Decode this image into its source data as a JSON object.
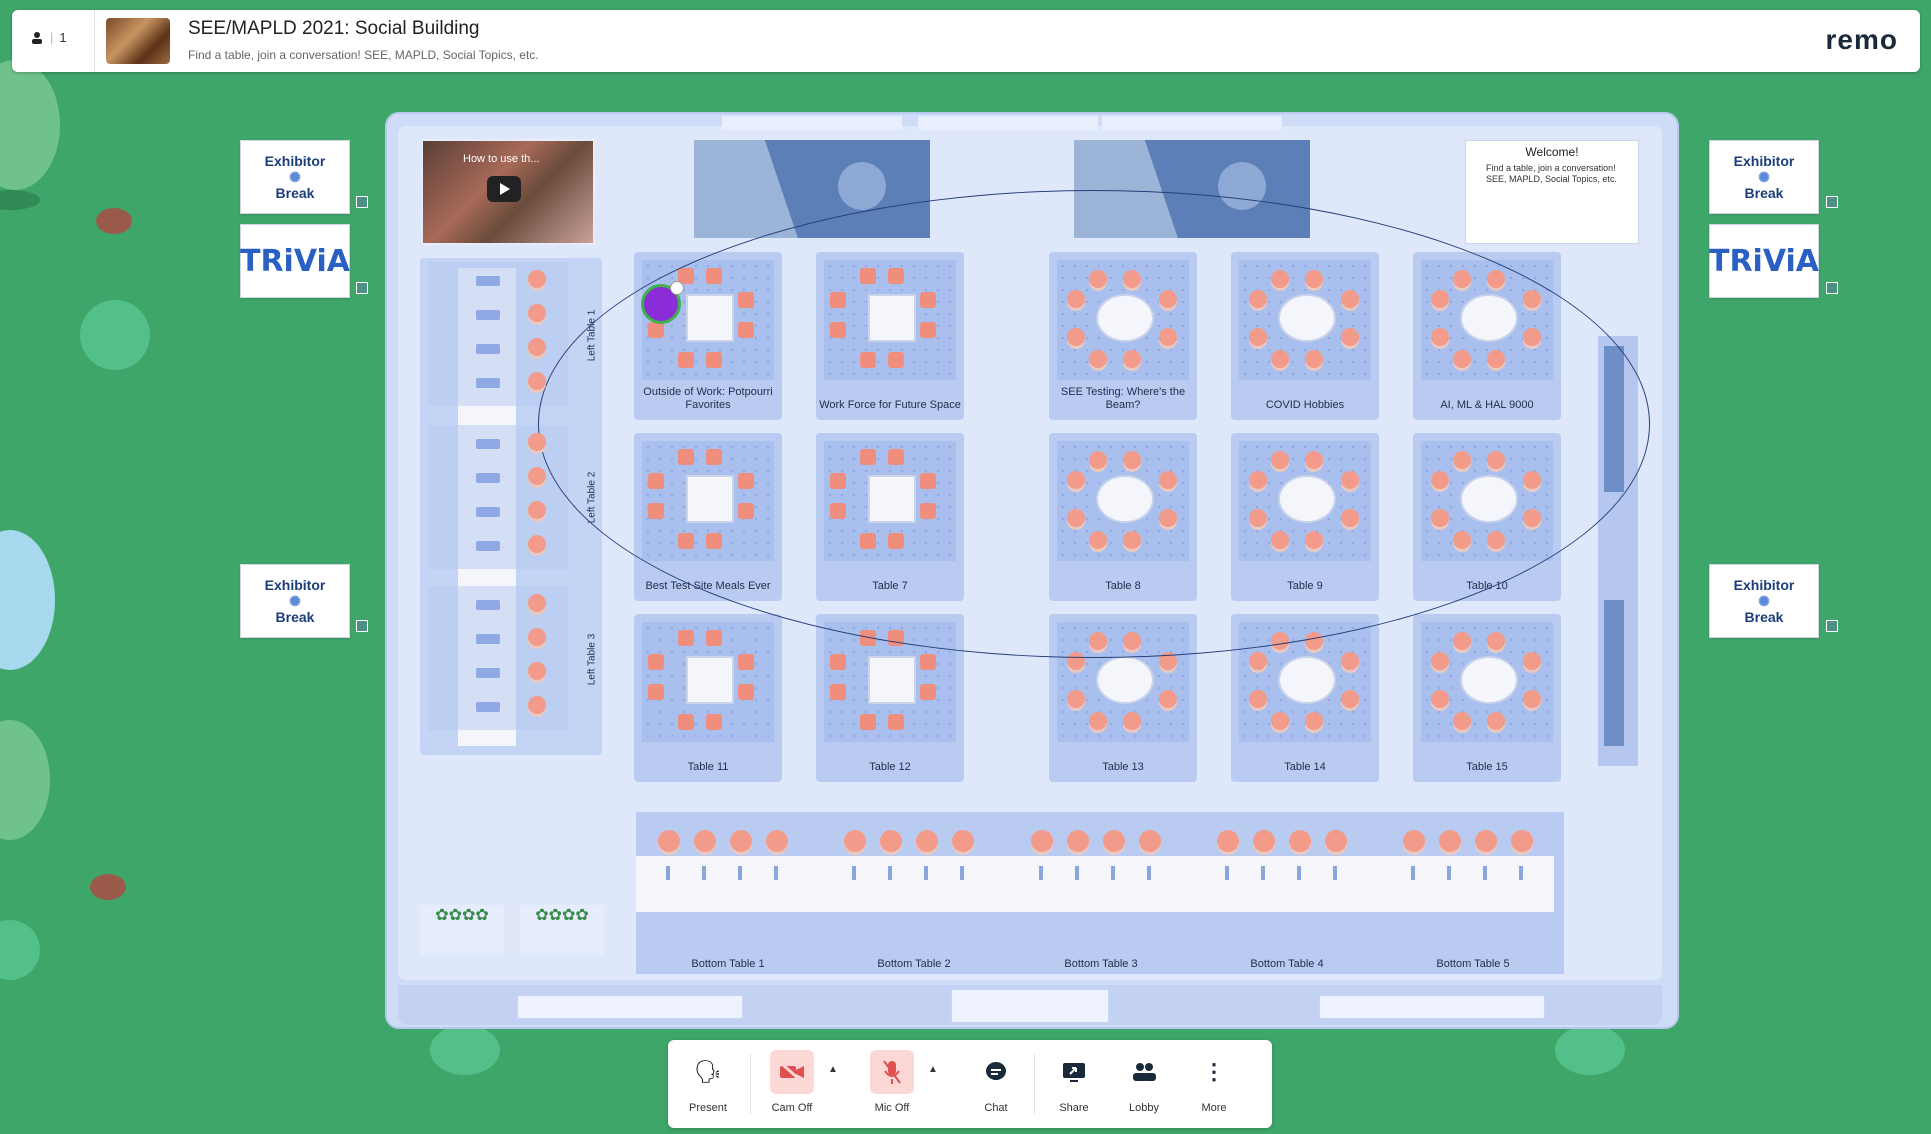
{
  "topbar": {
    "attendee_count": "1",
    "title": "SEE/MAPLD 2021: Social Building",
    "subtitle": "Find a table, join a conversation! SEE, MAPLD, Social Topics, etc.",
    "logo": "remo"
  },
  "side_panels": {
    "exhibitor_line1": "Exhibitor",
    "exhibitor_line2": "Break",
    "trivia": "TRiViA"
  },
  "video": {
    "caption": "How to use th..."
  },
  "welcome": {
    "title": "Welcome!",
    "text": "Find a table, join a conversation! SEE, MAPLD, Social Topics, etc."
  },
  "left_tables": [
    "Left Table 1",
    "Left Table 2",
    "Left Table 3"
  ],
  "tables": [
    {
      "label": "Outside of Work: Potpourri Favorites"
    },
    {
      "label": "Work Force for Future Space"
    },
    {
      "label": "SEE Testing: Where's the Beam?"
    },
    {
      "label": "COVID Hobbies"
    },
    {
      "label": "AI, ML & HAL 9000"
    },
    {
      "label": "Best Test Site Meals Ever"
    },
    {
      "label": "Table 7"
    },
    {
      "label": "Table 8"
    },
    {
      "label": "Table 9"
    },
    {
      "label": "Table 10"
    },
    {
      "label": "Table 11"
    },
    {
      "label": "Table 12"
    },
    {
      "label": "Table 13"
    },
    {
      "label": "Table 14"
    },
    {
      "label": "Table 15"
    }
  ],
  "bottom_tables": [
    "Bottom Table 1",
    "Bottom Table 2",
    "Bottom Table 3",
    "Bottom Table 4",
    "Bottom Table 5"
  ],
  "toolbar": {
    "present": "Present",
    "cam": "Cam Off",
    "mic": "Mic Off",
    "chat": "Chat",
    "share": "Share",
    "lobby": "Lobby",
    "more": "More"
  },
  "colors": {
    "background": "#3fa66a",
    "floor": "#cfdcf7",
    "chair": "#f08e7e",
    "accent_red": "#e05050"
  }
}
